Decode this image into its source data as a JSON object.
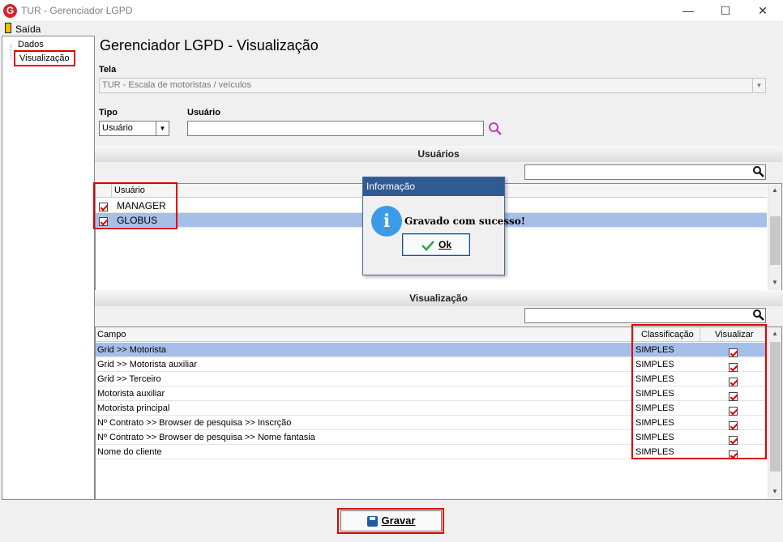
{
  "window": {
    "title": "TUR - Gerenciador LGPD",
    "app_icon_letter": "G"
  },
  "menu": {
    "saida": "Saída"
  },
  "tree": {
    "items": [
      {
        "label": "Dados"
      },
      {
        "label": "Visualização"
      }
    ]
  },
  "page": {
    "title": "Gerenciador LGPD - Visualização"
  },
  "tela": {
    "label": "Tela",
    "value": "TUR - Escala de motoristas / veículos"
  },
  "tipo": {
    "label": "Tipo",
    "value": "Usuário"
  },
  "usuario_filter": {
    "label": "Usuário",
    "value": ""
  },
  "usuarios_section": {
    "title": "Usuários",
    "search_value": "",
    "column": "Usuário",
    "rows": [
      {
        "name": "MANAGER",
        "checked": true
      },
      {
        "name": "GLOBUS",
        "checked": true,
        "selected": true
      }
    ]
  },
  "visualizacao_section": {
    "title": "Visualização",
    "search_value": "",
    "columns": {
      "campo": "Campo",
      "classificacao": "Classificação",
      "visualizar": "Visualizar"
    },
    "rows": [
      {
        "campo": "Grid >> Motorista",
        "classificacao": "SIMPLES",
        "visualizar": true,
        "selected": true
      },
      {
        "campo": "Grid >> Motorista auxiliar",
        "classificacao": "SIMPLES",
        "visualizar": true
      },
      {
        "campo": "Grid >> Terceiro",
        "classificacao": "SIMPLES",
        "visualizar": true
      },
      {
        "campo": "Motorista auxiliar",
        "classificacao": "SIMPLES",
        "visualizar": true
      },
      {
        "campo": "Motorista principal",
        "classificacao": "SIMPLES",
        "visualizar": true
      },
      {
        "campo": "Nº Contrato >> Browser de pesquisa >> Inscrção",
        "classificacao": "SIMPLES",
        "visualizar": true
      },
      {
        "campo": "Nº Contrato >> Browser de pesquisa >> Nome fantasia",
        "classificacao": "SIMPLES",
        "visualizar": true
      },
      {
        "campo": "Nome do cliente",
        "classificacao": "SIMPLES",
        "visualizar": true
      }
    ]
  },
  "dialog": {
    "title": "Informação",
    "message": "Gravado com sucesso!",
    "ok_label": "Ok",
    "icon_letter": "i"
  },
  "footer": {
    "gravar_label": "Gravar"
  },
  "colors": {
    "highlight_red": "#e00000",
    "selection_blue": "#a6bfe9",
    "dialog_header": "#2f5a92"
  }
}
